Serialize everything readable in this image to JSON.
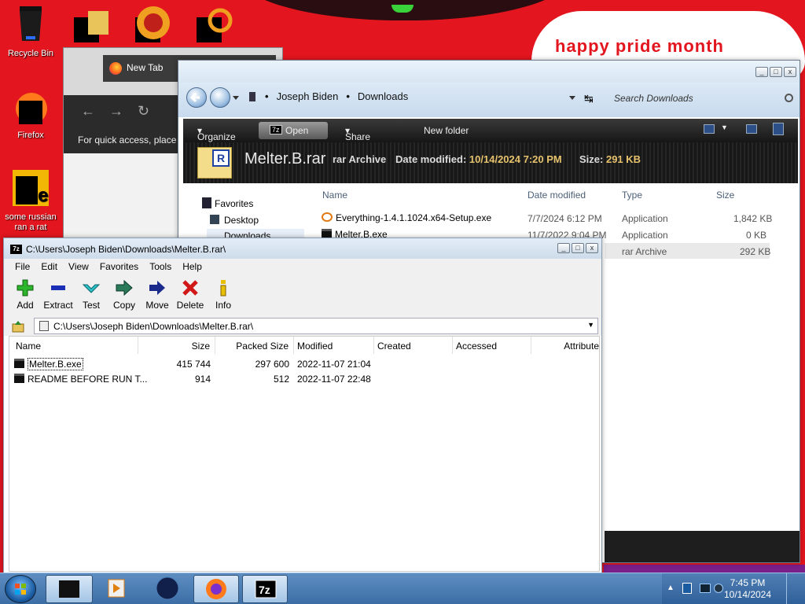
{
  "desktop": {
    "banner_text": "happy pride month",
    "icons": [
      {
        "label": "Recycle Bin"
      },
      {
        "label": "Firefox"
      },
      {
        "label": "some russian ran a rat"
      }
    ]
  },
  "browser": {
    "tab_label": "New Tab",
    "quick_access_text": "For quick access, place y"
  },
  "explorer": {
    "breadcrumbs": [
      "Joseph Biden",
      "Downloads"
    ],
    "search_placeholder": "Search Downloads",
    "toolbar": {
      "organize": "Organize",
      "open": "Open",
      "share_with": "Share with",
      "new_folder": "New folder"
    },
    "details": {
      "file_name": "Melter.B.rar",
      "file_type": "rar Archive",
      "date_label": "Date modified:",
      "date_value": "10/14/2024 7:20 PM",
      "size_label": "Size:",
      "size_value": "291 KB"
    },
    "nav": [
      "Favorites",
      "Desktop",
      "Downloads"
    ],
    "columns": [
      "Name",
      "Date modified",
      "Type",
      "Size"
    ],
    "files": [
      {
        "name": "Everything-1.4.1.1024.x64-Setup.exe",
        "date": "7/7/2024 6:12 PM",
        "type": "Application",
        "size": "1,842 KB"
      },
      {
        "name": "Melter.B.exe",
        "date": "11/7/2022 9:04 PM",
        "type": "Application",
        "size": "0 KB"
      },
      {
        "name": "",
        "date": "",
        "type": "rar Archive",
        "size": "292 KB"
      }
    ]
  },
  "zip": {
    "title": "C:\\Users\\Joseph Biden\\Downloads\\Melter.B.rar\\",
    "menu": [
      "File",
      "Edit",
      "View",
      "Favorites",
      "Tools",
      "Help"
    ],
    "tools": [
      "Add",
      "Extract",
      "Test",
      "Copy",
      "Move",
      "Delete",
      "Info"
    ],
    "path": "C:\\Users\\Joseph Biden\\Downloads\\Melter.B.rar\\",
    "columns": [
      "Name",
      "Size",
      "Packed Size",
      "Modified",
      "Created",
      "Accessed",
      "Attribute"
    ],
    "rows": [
      {
        "name": "Melter.B.exe",
        "size": "415 744",
        "packed": "297 600",
        "modified": "2022-11-07 21:04"
      },
      {
        "name": "README BEFORE RUN T...",
        "size": "914",
        "packed": "512",
        "modified": "2022-11-07 22:48"
      }
    ]
  },
  "taskbar": {
    "time": "7:45 PM",
    "date": "10/14/2024"
  }
}
